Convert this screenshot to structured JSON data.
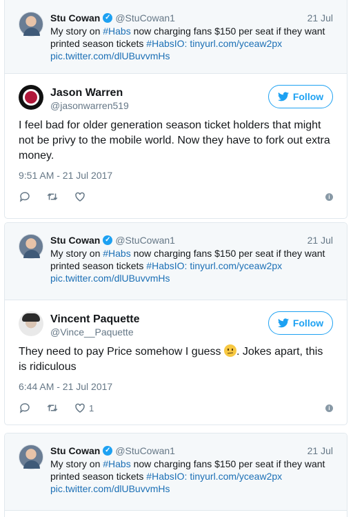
{
  "quoted_tweet": {
    "name": "Stu Cowan",
    "handle": "@StuCowan1",
    "date": "21 Jul",
    "text_before": "My story on ",
    "hashtag_1": "#Habs",
    "text_middle": " now charging fans $150 per seat if they want printed season tickets ",
    "hashtag_2": "#HabsIO",
    "colon": ": ",
    "link": "tinyurl.com/yceaw2px",
    "pic_link": "pic.twitter.com/dlUBuvvmHs"
  },
  "replies": [
    {
      "name": "Jason Warren",
      "handle": "@jasonwarren519",
      "follow_label": "Follow",
      "text": "I feel bad for older generation season ticket holders that might not be privy to the mobile world. Now they have to fork out extra money.",
      "time": "9:51 AM - 21 Jul 2017",
      "like_count": ""
    },
    {
      "name": "Vincent Paquette",
      "handle": "@Vince__Paquette",
      "follow_label": "Follow",
      "text_before_emoji": "They need to pay Price somehow I guess ",
      "text_after_emoji": ". Jokes apart, this is ridiculous",
      "time": "6:44 AM - 21 Jul 2017",
      "like_count": "1"
    }
  ],
  "icons": {
    "verified": "verified-badge-icon",
    "follow": "twitter-bird-icon",
    "reply": "reply-icon",
    "retweet": "retweet-icon",
    "like": "heart-icon",
    "info": "info-icon"
  },
  "colors": {
    "accent": "#1da1f2",
    "link": "#1b6fb5",
    "muted": "#657786",
    "quoted_bg": "#f5f8fa"
  }
}
